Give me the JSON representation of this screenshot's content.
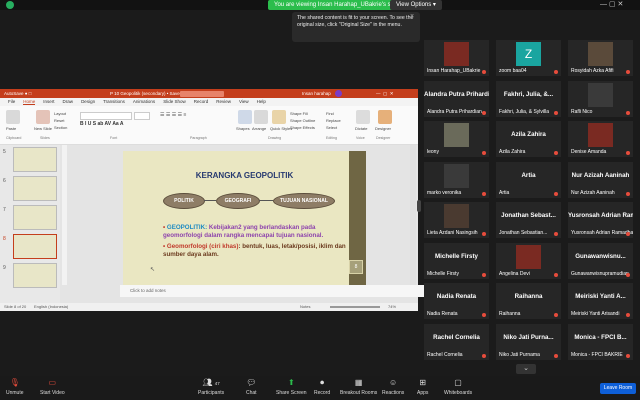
{
  "topbar": {
    "viewing_label": "You are viewing Insan Harahap_UBakrie's screen",
    "view_options_label": "View Options",
    "tooltip_text": "The shared content is fit to your screen. To see the original size, click \"Original Size\" in the menu."
  },
  "ppt": {
    "title": "P 10 Geopolitik (secondary) • Saved to this PC",
    "user": "Insan harahap",
    "menu": [
      "File",
      "Home",
      "Insert",
      "Draw",
      "Design",
      "Transitions",
      "Animations",
      "Slide Show",
      "Record",
      "Review",
      "View",
      "Help"
    ],
    "ribbon": {
      "paste": "Paste",
      "new_slide": "New Slide",
      "layout": "Layout",
      "reset": "Reset",
      "section": "Section",
      "shapes": "Shapes",
      "arrange": "Arrange",
      "quick_styles": "Quick Styles",
      "shape_fill": "Shape Fill",
      "shape_outline": "Shape Outline",
      "shape_effects": "Shape Effects",
      "find": "Find",
      "replace": "Replace",
      "select": "Select",
      "dictate": "Dictate",
      "designer": "Designer",
      "groups": [
        "Clipboard",
        "Slides",
        "Font",
        "Paragraph",
        "Drawing",
        "Editing",
        "Voice",
        "Designer"
      ]
    },
    "slide_numbers": [
      "5",
      "6",
      "7",
      "8",
      "9"
    ],
    "current_slide": "8",
    "slide": {
      "title": "KERANGKA GEOPOLITIK",
      "oval1": "POLITIK",
      "oval2": "GEOGRAFI",
      "oval3": "TUJUAN NASIONAL",
      "b1_key": "GEOPOLITIK: ",
      "b1_text": "Kebijakan2 yang berlandaskan pada geomorfologi dalam rangka mencapai tujuan nasional.",
      "b2_key": "Geomorfologi (ciri khas)",
      "b2_text": ": bentuk, luas, letak/posisi, iklim dan sumber daya alam.",
      "page_number": "8"
    },
    "notes_placeholder": "Click to add notes",
    "status_left": "Slide 8 of 20",
    "status_lang": "English (Indonesia)",
    "status_notes": "Notes",
    "status_zoom": "74%"
  },
  "gallery": [
    {
      "name": "Insan Harahap_UBakrie",
      "kind": "video"
    },
    {
      "name": "zoom baa04",
      "kind": "letter",
      "letter": "Z"
    },
    {
      "name": "Rosyidah Azka Afifi",
      "kind": "video"
    },
    {
      "name": "Alandra Putra Prihardian...",
      "kind": "text",
      "big": "Alandra Putra Prihardian..."
    },
    {
      "name": "Fakhri, Julia, & Sylvilla",
      "kind": "text",
      "big": "Fakhri, Julia, &..."
    },
    {
      "name": "Rafli Nico",
      "kind": "video"
    },
    {
      "name": "leony",
      "kind": "video"
    },
    {
      "name": "Azila Zahira",
      "kind": "text",
      "big": "Azila Zahira"
    },
    {
      "name": "Denise Amanda",
      "kind": "video"
    },
    {
      "name": "marko veronika",
      "kind": "video"
    },
    {
      "name": "Artia",
      "kind": "text",
      "big": "Artia"
    },
    {
      "name": "Nur Azizah Aaninah",
      "kind": "text",
      "big": "Nur Azizah Aaninah"
    },
    {
      "name": "Lieta Azdani Nasingsih",
      "kind": "video"
    },
    {
      "name": "Jonathan Sebastian...",
      "kind": "text",
      "big": "Jonathan Sebast..."
    },
    {
      "name": "Yusronsah Adrian Ramadhan",
      "kind": "text",
      "big": "Yusronsah Adrian Rama..."
    },
    {
      "name": "Michelle Firsty",
      "kind": "text",
      "big": "Michelle Firsty"
    },
    {
      "name": "Angelina Devi",
      "kind": "video"
    },
    {
      "name": "Gunawanwisnupramudian",
      "kind": "text",
      "big": "Gunawanwisnu..."
    },
    {
      "name": "Nadia Renata",
      "kind": "text",
      "big": "Nadia Renata"
    },
    {
      "name": "Raihanna",
      "kind": "text",
      "big": "Raihanna"
    },
    {
      "name": "Meiriski Yanti Arisandi",
      "kind": "text",
      "big": "Meiriski Yanti A..."
    },
    {
      "name": "Rachel Cornelia",
      "kind": "text",
      "big": "Rachel Cornelia"
    },
    {
      "name": "Niko Jati Purnama",
      "kind": "text",
      "big": "Niko Jati Purna..."
    },
    {
      "name": "Monica - FPCI BAKRIE",
      "kind": "text",
      "big": "Monica - FPCI B..."
    }
  ],
  "toolbar": {
    "unmute": "Unmute",
    "start_video": "Start Video",
    "participants": "Participants",
    "participants_count": "47",
    "chat": "Chat",
    "share_screen": "Share Screen",
    "record": "Record",
    "breakout": "Breakout Rooms",
    "reactions": "Reactions",
    "apps": "Apps",
    "whiteboards": "Whiteboards",
    "leave": "Leave Room"
  },
  "colors": {
    "accent_green": "#2bbd4c",
    "ppt_red": "#c43e1c",
    "leave_blue": "#0e5fd8",
    "slide_title": "#273a70"
  }
}
